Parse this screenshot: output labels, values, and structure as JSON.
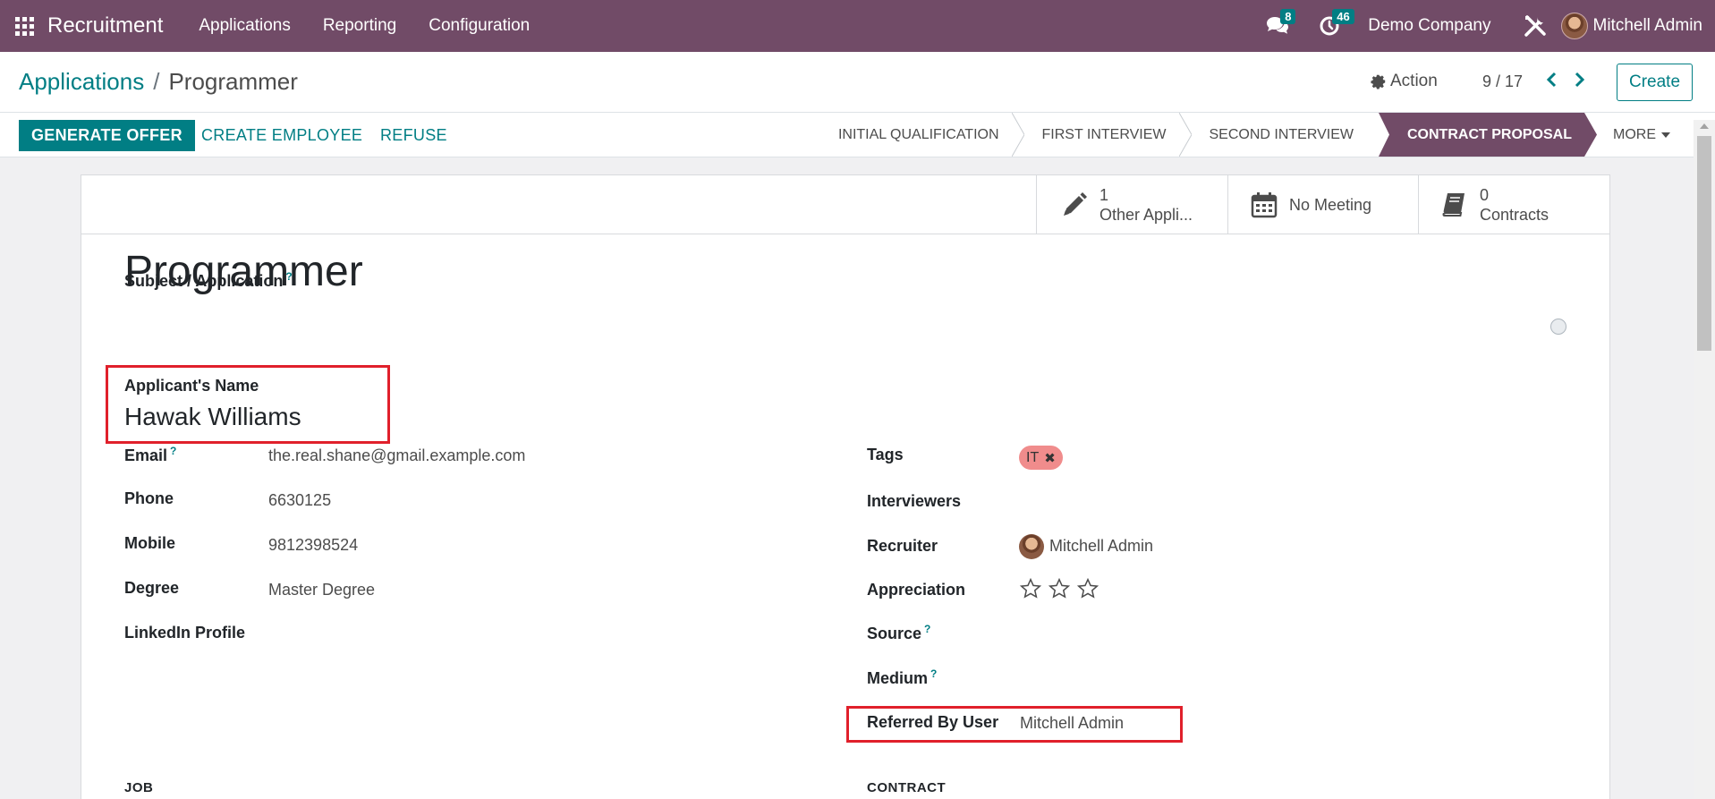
{
  "app": {
    "name": "Recruitment",
    "menu": [
      "Applications",
      "Reporting",
      "Configuration"
    ],
    "messages_count": "8",
    "activities_count": "46",
    "company": "Demo Company",
    "user": "Mitchell Admin"
  },
  "control": {
    "breadcrumb_parent": "Applications",
    "breadcrumb_sep": "/",
    "breadcrumb_current": "Programmer",
    "action_label": "Action",
    "pager": "9 / 17",
    "create_label": "Create"
  },
  "statusbar": {
    "generate_offer": "GENERATE OFFER",
    "create_employee": "CREATE EMPLOYEE",
    "refuse": "REFUSE",
    "stages": [
      "INITIAL QUALIFICATION",
      "FIRST INTERVIEW",
      "SECOND INTERVIEW",
      "CONTRACT PROPOSAL"
    ],
    "active_stage": "CONTRACT PROPOSAL",
    "more": "MORE"
  },
  "smart_buttons": {
    "other_applications_count": "1",
    "other_applications_label": "Other Appli...",
    "meeting_label": "No Meeting",
    "contracts_count": "0",
    "contracts_label": "Contracts"
  },
  "form": {
    "subject_label": "Subject / Application",
    "title": "Programmer",
    "applicant_name_label": "Applicant's Name",
    "applicant_name": "Hawak Williams",
    "left_fields": [
      {
        "label": "Email",
        "value": "the.real.shane@gmail.example.com"
      },
      {
        "label": "Phone",
        "value": "6630125"
      },
      {
        "label": "Mobile",
        "value": "9812398524"
      },
      {
        "label": "Degree",
        "value": "Master Degree"
      },
      {
        "label": "LinkedIn Profile",
        "value": ""
      }
    ],
    "right_fields": {
      "tags_label": "Tags",
      "tag": "IT",
      "interviewers_label": "Interviewers",
      "recruiter_label": "Recruiter",
      "recruiter": "Mitchell Admin",
      "appreciation_label": "Appreciation",
      "appreciation_stars": 0,
      "source_label": "Source",
      "medium_label": "Medium",
      "referred_label": "Referred By User",
      "referred_value": "Mitchell Admin"
    },
    "help_mark": "?",
    "job_section": "JOB",
    "contract_section": "CONTRACT"
  },
  "colors": {
    "navbar": "#714b67",
    "primary": "#017e84",
    "highlight": "#e0202b",
    "tag": "#f08c8c"
  }
}
